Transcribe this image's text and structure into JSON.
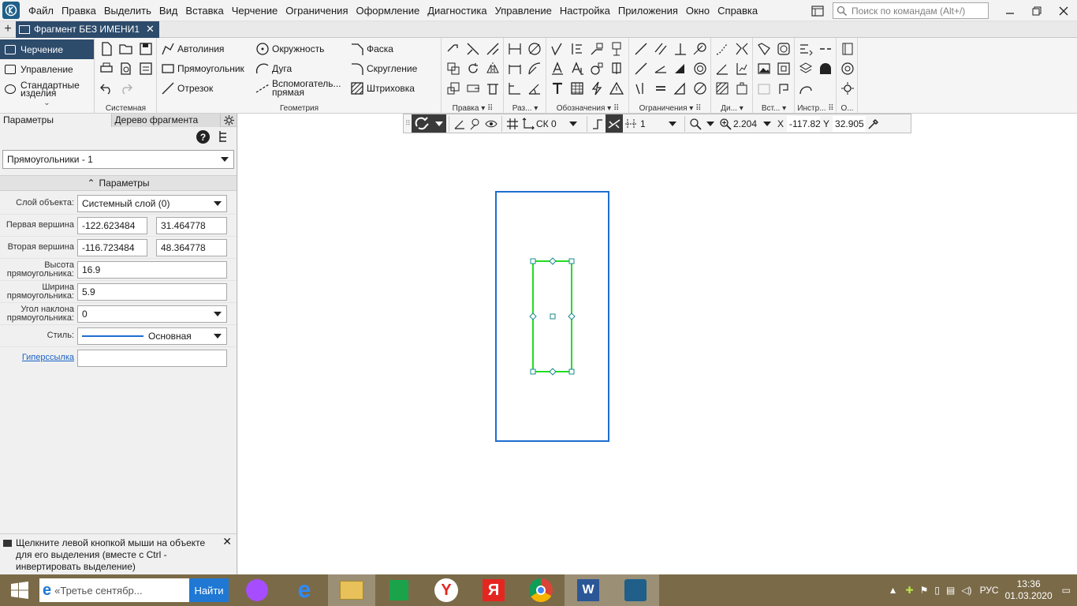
{
  "menubar": {
    "items": [
      "Файл",
      "Правка",
      "Выделить",
      "Вид",
      "Вставка",
      "Черчение",
      "Ограничения",
      "Оформление",
      "Диагностика",
      "Управление",
      "Настройка",
      "Приложения",
      "Окно",
      "Справка"
    ],
    "search_placeholder": "Поиск по командам (Alt+/)"
  },
  "tabs": {
    "document": "Фрагмент БЕЗ ИМЕНИ1"
  },
  "ribbon": {
    "nav": {
      "drawing": "Черчение",
      "control": "Управление",
      "standard": "Стандартные изделия"
    },
    "groups": {
      "system": "Системная",
      "geometry": "Геометрия",
      "edit": "Правка",
      "sizes": "Раз...",
      "designations": "Обозначения",
      "constraints": "Ограничения",
      "di": "Ди...",
      "insert": "Вст...",
      "tools": "Инстр...",
      "o": "О..."
    },
    "geometry_tools": {
      "autoline": "Автолиния",
      "rectangle": "Прямоугольник",
      "segment": "Отрезок",
      "circle": "Окружность",
      "arc": "Дуга",
      "aux_line_1": "Вспомогатель...",
      "aux_line_2": "прямая",
      "chamfer": "Фаска",
      "fillet": "Скругление",
      "hatch": "Штриховка"
    }
  },
  "panel": {
    "tab_params": "Параметры",
    "tab_tree": "Дерево фрагмента",
    "object_select": "Прямоугольники - 1",
    "section": "Параметры",
    "layer_label": "Слой объекта:",
    "layer_value": "Системный слой (0)",
    "first_vertex_label": "Первая вершина",
    "first_vertex_x": "-122.623484",
    "first_vertex_y": "31.464778",
    "second_vertex_label": "Вторая вершина",
    "second_vertex_x": "-116.723484",
    "second_vertex_y": "48.364778",
    "height_label_1": "Высота",
    "height_label_2": "прямоугольника:",
    "height_value": "16.9",
    "width_label_1": "Ширина",
    "width_label_2": "прямоугольника:",
    "width_value": "5.9",
    "angle_label_1": "Угол наклона",
    "angle_label_2": "прямоугольника:",
    "angle_value": "0",
    "style_label": "Стиль:",
    "style_value": "Основная",
    "hyperlink_label": "Гиперссылка",
    "hyperlink_value": "",
    "hint": "Щелкните левой кнопкой мыши на объекте для его выделения (вместе с Ctrl - инвертировать выделение)"
  },
  "cad_toolbar": {
    "cs": "СК 0",
    "step": "1",
    "zoom": "2.204",
    "x_label": "X",
    "x_value": "-117.82",
    "y_label": "Y",
    "y_value": "32.905"
  },
  "taskbar": {
    "search_text": "«Третье сентябр...",
    "find_button": "Найти",
    "lang": "РУС",
    "time": "13:36",
    "date": "01.03.2020"
  },
  "colors": {
    "accent": "#2d4b6b",
    "sheet_frame": "#1e6fd0",
    "selected_rect": "#22dd22",
    "handle": "#1a8a8a"
  }
}
